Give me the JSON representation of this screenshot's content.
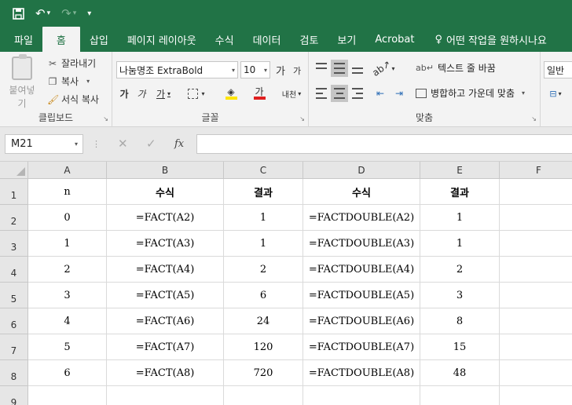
{
  "ribbon_tabs": [
    "파일",
    "홈",
    "삽입",
    "페이지 레이아웃",
    "수식",
    "데이터",
    "검토",
    "보기",
    "Acrobat"
  ],
  "tell_me": "어떤 작업을 원하시나요",
  "clipboard": {
    "paste": "붙여넣기",
    "cut": "잘라내기",
    "copy": "복사",
    "format_painter": "서식 복사",
    "label": "클립보드"
  },
  "font": {
    "name": "나눔명조 ExtraBold",
    "size": "10",
    "grow": "가",
    "shrink": "가",
    "bold": "가",
    "italic": "가",
    "underline": "가",
    "font_color": "가",
    "phonetic": "내천",
    "label": "글꼴"
  },
  "alignment": {
    "wrap_text": "텍스트 줄 바꿈",
    "merge_center": "병합하고 가운데 맞춤",
    "label": "맞춤"
  },
  "number": {
    "format": "일반"
  },
  "formula_bar": {
    "name_box": "M21",
    "fx": "fx",
    "content": ""
  },
  "columns": [
    "A",
    "B",
    "C",
    "D",
    "E",
    "F"
  ],
  "rows": [
    [
      "n",
      "수식",
      "결과",
      "수식",
      "결과",
      ""
    ],
    [
      "0",
      "=FACT(A2)",
      "1",
      "=FACTDOUBLE(A2)",
      "1",
      ""
    ],
    [
      "1",
      "=FACT(A3)",
      "1",
      "=FACTDOUBLE(A3)",
      "1",
      ""
    ],
    [
      "2",
      "=FACT(A4)",
      "2",
      "=FACTDOUBLE(A4)",
      "2",
      ""
    ],
    [
      "3",
      "=FACT(A5)",
      "6",
      "=FACTDOUBLE(A5)",
      "3",
      ""
    ],
    [
      "4",
      "=FACT(A6)",
      "24",
      "=FACTDOUBLE(A6)",
      "8",
      ""
    ],
    [
      "5",
      "=FACT(A7)",
      "120",
      "=FACTDOUBLE(A7)",
      "15",
      ""
    ],
    [
      "6",
      "=FACT(A8)",
      "720",
      "=FACTDOUBLE(A8)",
      "48",
      ""
    ],
    [
      "",
      "",
      "",
      "",
      "",
      ""
    ]
  ],
  "row_numbers": [
    "1",
    "2",
    "3",
    "4",
    "5",
    "6",
    "7",
    "8",
    "9"
  ],
  "colors": {
    "excel_green": "#217346",
    "font_color_bar": "#e01f1f",
    "highlight_bar": "#ffe500"
  }
}
